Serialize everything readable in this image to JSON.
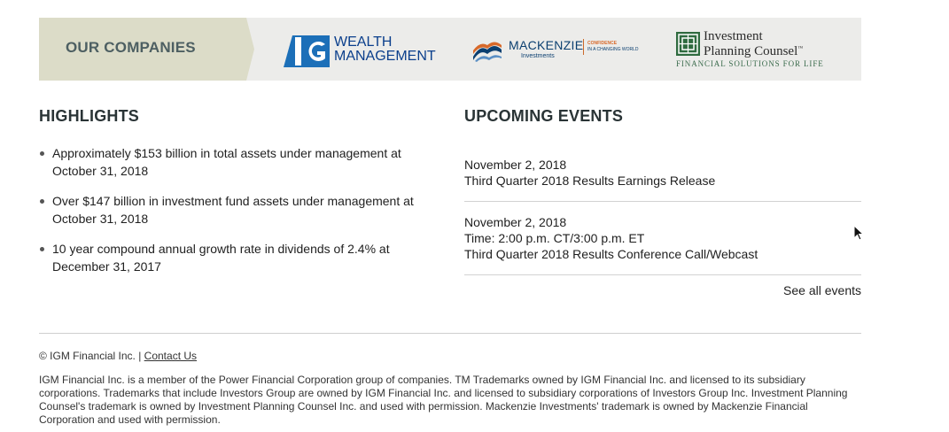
{
  "banner": {
    "label": "OUR COMPANIES",
    "ig_wealth": {
      "line1": "WEALTH",
      "line2": "MANAGEMENT"
    },
    "mackenzie": {
      "name": "MACKENZIE",
      "sub": "Investments",
      "tag_line1": "CONFIDENCE",
      "tag_line2": "IN A CHANGING WORLD"
    },
    "ipc": {
      "line1": "Investment",
      "line2": "Planning Counsel",
      "tm": "™",
      "tagline": "FINANCIAL SOLUTIONS FOR LIFE"
    }
  },
  "highlights": {
    "title": "HIGHLIGHTS",
    "items": [
      "Approximately $153 billion in total assets under management at October 31, 2018",
      "Over $147 billion in investment fund assets under management at October 31, 2018",
      "10 year compound annual growth rate in dividends of 2.4% at December 31, 2017"
    ]
  },
  "events": {
    "title": "UPCOMING EVENTS",
    "items": [
      {
        "date": "November 2, 2018",
        "time": "",
        "description": "Third Quarter 2018 Results Earnings Release"
      },
      {
        "date": "November 2, 2018",
        "time": "Time: 2:00 p.m. CT/3:00 p.m. ET",
        "description": "Third Quarter 2018 Results Conference Call/Webcast"
      }
    ],
    "see_all": "See all events"
  },
  "footer": {
    "copyright": "© IGM Financial Inc. |",
    "contact_link": "Contact Us",
    "legal": "IGM Financial Inc. is a member of the Power Financial Corporation group of companies. TM Trademarks owned by IGM Financial Inc. and licensed to its subsidiary corporations. Trademarks that include Investors Group are owned by IGM Financial Inc. and licensed to subsidiary corporations of Investors Group Inc. Investment Planning Counsel's trademark is owned by Investment Planning Counsel Inc. and used with permission. Mackenzie Investments' trademark is owned by Mackenzie Financial Corporation and used with permission."
  },
  "colors": {
    "banner_bg": "#ececea",
    "banner_label_bg": "#dcdcc8",
    "ig_blue": "#0b3f8c",
    "mackenzie_orange": "#d8692a",
    "ipc_green": "#2f6b3f"
  }
}
